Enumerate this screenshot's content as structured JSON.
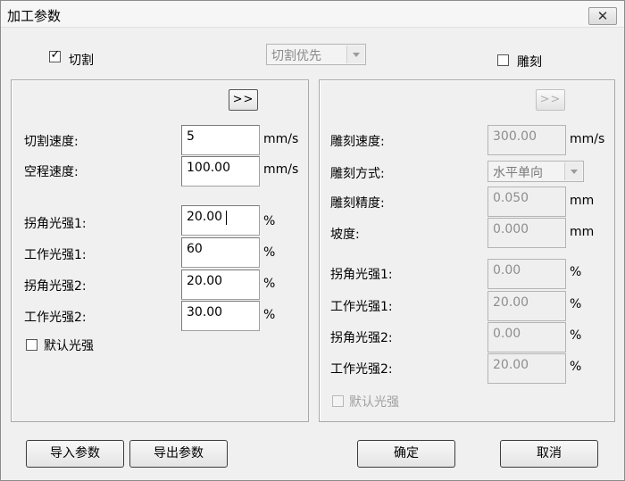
{
  "window": {
    "title": "加工参数",
    "close_glyph": "✕"
  },
  "cut": {
    "enable_label": "切割",
    "enable_checked": true,
    "priority_select": "切割优先",
    "expand_button": ">>",
    "fields": [
      {
        "label": "切割速度:",
        "value": "5",
        "unit": "mm/s"
      },
      {
        "label": "空程速度:",
        "value": "100.00",
        "unit": "mm/s"
      },
      {
        "label": "拐角光强1:",
        "value": "20.00",
        "unit": "%"
      },
      {
        "label": "工作光强1:",
        "value": "60",
        "unit": "%"
      },
      {
        "label": "拐角光强2:",
        "value": "20.00",
        "unit": "%"
      },
      {
        "label": "工作光强2:",
        "value": "30.00",
        "unit": "%"
      }
    ],
    "default_power_label": "默认光强",
    "default_power_checked": false
  },
  "engrave": {
    "enable_label": "雕刻",
    "enable_checked": false,
    "expand_button": ">>",
    "speed": {
      "label": "雕刻速度:",
      "value": "300.00",
      "unit": "mm/s"
    },
    "mode": {
      "label": "雕刻方式:",
      "value": "水平单向"
    },
    "precision": {
      "label": "雕刻精度:",
      "value": "0.050",
      "unit": "mm"
    },
    "slope": {
      "label": "坡度:",
      "value": "0.000",
      "unit": "mm"
    },
    "fields": [
      {
        "label": "拐角光强1:",
        "value": "0.00",
        "unit": "%"
      },
      {
        "label": "工作光强1:",
        "value": "20.00",
        "unit": "%"
      },
      {
        "label": "拐角光强2:",
        "value": "0.00",
        "unit": "%"
      },
      {
        "label": "工作光强2:",
        "value": "20.00",
        "unit": "%"
      }
    ],
    "default_power_label": "默认光强",
    "default_power_checked": false
  },
  "footer": {
    "import_label": "导入参数",
    "export_label": "导出参数",
    "ok_label": "确定",
    "cancel_label": "取消"
  },
  "colors": {
    "dialog_bg": "#f0f0f0",
    "disabled_text": "#a0a0a0"
  }
}
